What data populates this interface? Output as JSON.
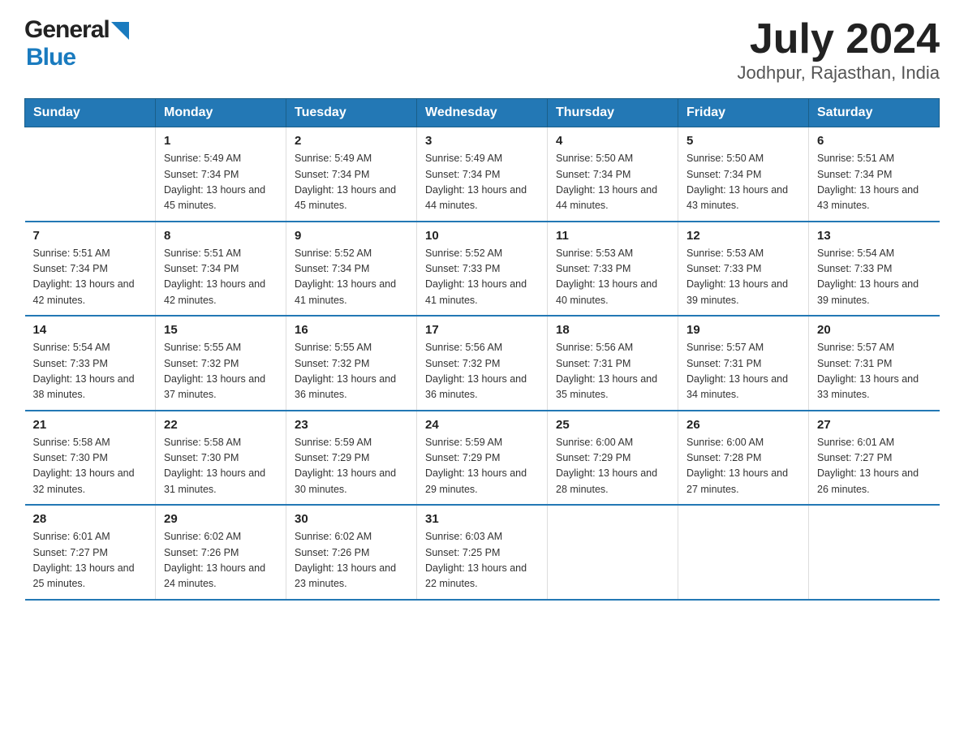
{
  "header": {
    "logo_general": "General",
    "logo_blue": "Blue",
    "month": "July 2024",
    "location": "Jodhpur, Rajasthan, India"
  },
  "days_of_week": [
    "Sunday",
    "Monday",
    "Tuesday",
    "Wednesday",
    "Thursday",
    "Friday",
    "Saturday"
  ],
  "weeks": [
    [
      {
        "day": "",
        "sunrise": "",
        "sunset": "",
        "daylight": ""
      },
      {
        "day": "1",
        "sunrise": "Sunrise: 5:49 AM",
        "sunset": "Sunset: 7:34 PM",
        "daylight": "Daylight: 13 hours and 45 minutes."
      },
      {
        "day": "2",
        "sunrise": "Sunrise: 5:49 AM",
        "sunset": "Sunset: 7:34 PM",
        "daylight": "Daylight: 13 hours and 45 minutes."
      },
      {
        "day": "3",
        "sunrise": "Sunrise: 5:49 AM",
        "sunset": "Sunset: 7:34 PM",
        "daylight": "Daylight: 13 hours and 44 minutes."
      },
      {
        "day": "4",
        "sunrise": "Sunrise: 5:50 AM",
        "sunset": "Sunset: 7:34 PM",
        "daylight": "Daylight: 13 hours and 44 minutes."
      },
      {
        "day": "5",
        "sunrise": "Sunrise: 5:50 AM",
        "sunset": "Sunset: 7:34 PM",
        "daylight": "Daylight: 13 hours and 43 minutes."
      },
      {
        "day": "6",
        "sunrise": "Sunrise: 5:51 AM",
        "sunset": "Sunset: 7:34 PM",
        "daylight": "Daylight: 13 hours and 43 minutes."
      }
    ],
    [
      {
        "day": "7",
        "sunrise": "Sunrise: 5:51 AM",
        "sunset": "Sunset: 7:34 PM",
        "daylight": "Daylight: 13 hours and 42 minutes."
      },
      {
        "day": "8",
        "sunrise": "Sunrise: 5:51 AM",
        "sunset": "Sunset: 7:34 PM",
        "daylight": "Daylight: 13 hours and 42 minutes."
      },
      {
        "day": "9",
        "sunrise": "Sunrise: 5:52 AM",
        "sunset": "Sunset: 7:34 PM",
        "daylight": "Daylight: 13 hours and 41 minutes."
      },
      {
        "day": "10",
        "sunrise": "Sunrise: 5:52 AM",
        "sunset": "Sunset: 7:33 PM",
        "daylight": "Daylight: 13 hours and 41 minutes."
      },
      {
        "day": "11",
        "sunrise": "Sunrise: 5:53 AM",
        "sunset": "Sunset: 7:33 PM",
        "daylight": "Daylight: 13 hours and 40 minutes."
      },
      {
        "day": "12",
        "sunrise": "Sunrise: 5:53 AM",
        "sunset": "Sunset: 7:33 PM",
        "daylight": "Daylight: 13 hours and 39 minutes."
      },
      {
        "day": "13",
        "sunrise": "Sunrise: 5:54 AM",
        "sunset": "Sunset: 7:33 PM",
        "daylight": "Daylight: 13 hours and 39 minutes."
      }
    ],
    [
      {
        "day": "14",
        "sunrise": "Sunrise: 5:54 AM",
        "sunset": "Sunset: 7:33 PM",
        "daylight": "Daylight: 13 hours and 38 minutes."
      },
      {
        "day": "15",
        "sunrise": "Sunrise: 5:55 AM",
        "sunset": "Sunset: 7:32 PM",
        "daylight": "Daylight: 13 hours and 37 minutes."
      },
      {
        "day": "16",
        "sunrise": "Sunrise: 5:55 AM",
        "sunset": "Sunset: 7:32 PM",
        "daylight": "Daylight: 13 hours and 36 minutes."
      },
      {
        "day": "17",
        "sunrise": "Sunrise: 5:56 AM",
        "sunset": "Sunset: 7:32 PM",
        "daylight": "Daylight: 13 hours and 36 minutes."
      },
      {
        "day": "18",
        "sunrise": "Sunrise: 5:56 AM",
        "sunset": "Sunset: 7:31 PM",
        "daylight": "Daylight: 13 hours and 35 minutes."
      },
      {
        "day": "19",
        "sunrise": "Sunrise: 5:57 AM",
        "sunset": "Sunset: 7:31 PM",
        "daylight": "Daylight: 13 hours and 34 minutes."
      },
      {
        "day": "20",
        "sunrise": "Sunrise: 5:57 AM",
        "sunset": "Sunset: 7:31 PM",
        "daylight": "Daylight: 13 hours and 33 minutes."
      }
    ],
    [
      {
        "day": "21",
        "sunrise": "Sunrise: 5:58 AM",
        "sunset": "Sunset: 7:30 PM",
        "daylight": "Daylight: 13 hours and 32 minutes."
      },
      {
        "day": "22",
        "sunrise": "Sunrise: 5:58 AM",
        "sunset": "Sunset: 7:30 PM",
        "daylight": "Daylight: 13 hours and 31 minutes."
      },
      {
        "day": "23",
        "sunrise": "Sunrise: 5:59 AM",
        "sunset": "Sunset: 7:29 PM",
        "daylight": "Daylight: 13 hours and 30 minutes."
      },
      {
        "day": "24",
        "sunrise": "Sunrise: 5:59 AM",
        "sunset": "Sunset: 7:29 PM",
        "daylight": "Daylight: 13 hours and 29 minutes."
      },
      {
        "day": "25",
        "sunrise": "Sunrise: 6:00 AM",
        "sunset": "Sunset: 7:29 PM",
        "daylight": "Daylight: 13 hours and 28 minutes."
      },
      {
        "day": "26",
        "sunrise": "Sunrise: 6:00 AM",
        "sunset": "Sunset: 7:28 PM",
        "daylight": "Daylight: 13 hours and 27 minutes."
      },
      {
        "day": "27",
        "sunrise": "Sunrise: 6:01 AM",
        "sunset": "Sunset: 7:27 PM",
        "daylight": "Daylight: 13 hours and 26 minutes."
      }
    ],
    [
      {
        "day": "28",
        "sunrise": "Sunrise: 6:01 AM",
        "sunset": "Sunset: 7:27 PM",
        "daylight": "Daylight: 13 hours and 25 minutes."
      },
      {
        "day": "29",
        "sunrise": "Sunrise: 6:02 AM",
        "sunset": "Sunset: 7:26 PM",
        "daylight": "Daylight: 13 hours and 24 minutes."
      },
      {
        "day": "30",
        "sunrise": "Sunrise: 6:02 AM",
        "sunset": "Sunset: 7:26 PM",
        "daylight": "Daylight: 13 hours and 23 minutes."
      },
      {
        "day": "31",
        "sunrise": "Sunrise: 6:03 AM",
        "sunset": "Sunset: 7:25 PM",
        "daylight": "Daylight: 13 hours and 22 minutes."
      },
      {
        "day": "",
        "sunrise": "",
        "sunset": "",
        "daylight": ""
      },
      {
        "day": "",
        "sunrise": "",
        "sunset": "",
        "daylight": ""
      },
      {
        "day": "",
        "sunrise": "",
        "sunset": "",
        "daylight": ""
      }
    ]
  ]
}
